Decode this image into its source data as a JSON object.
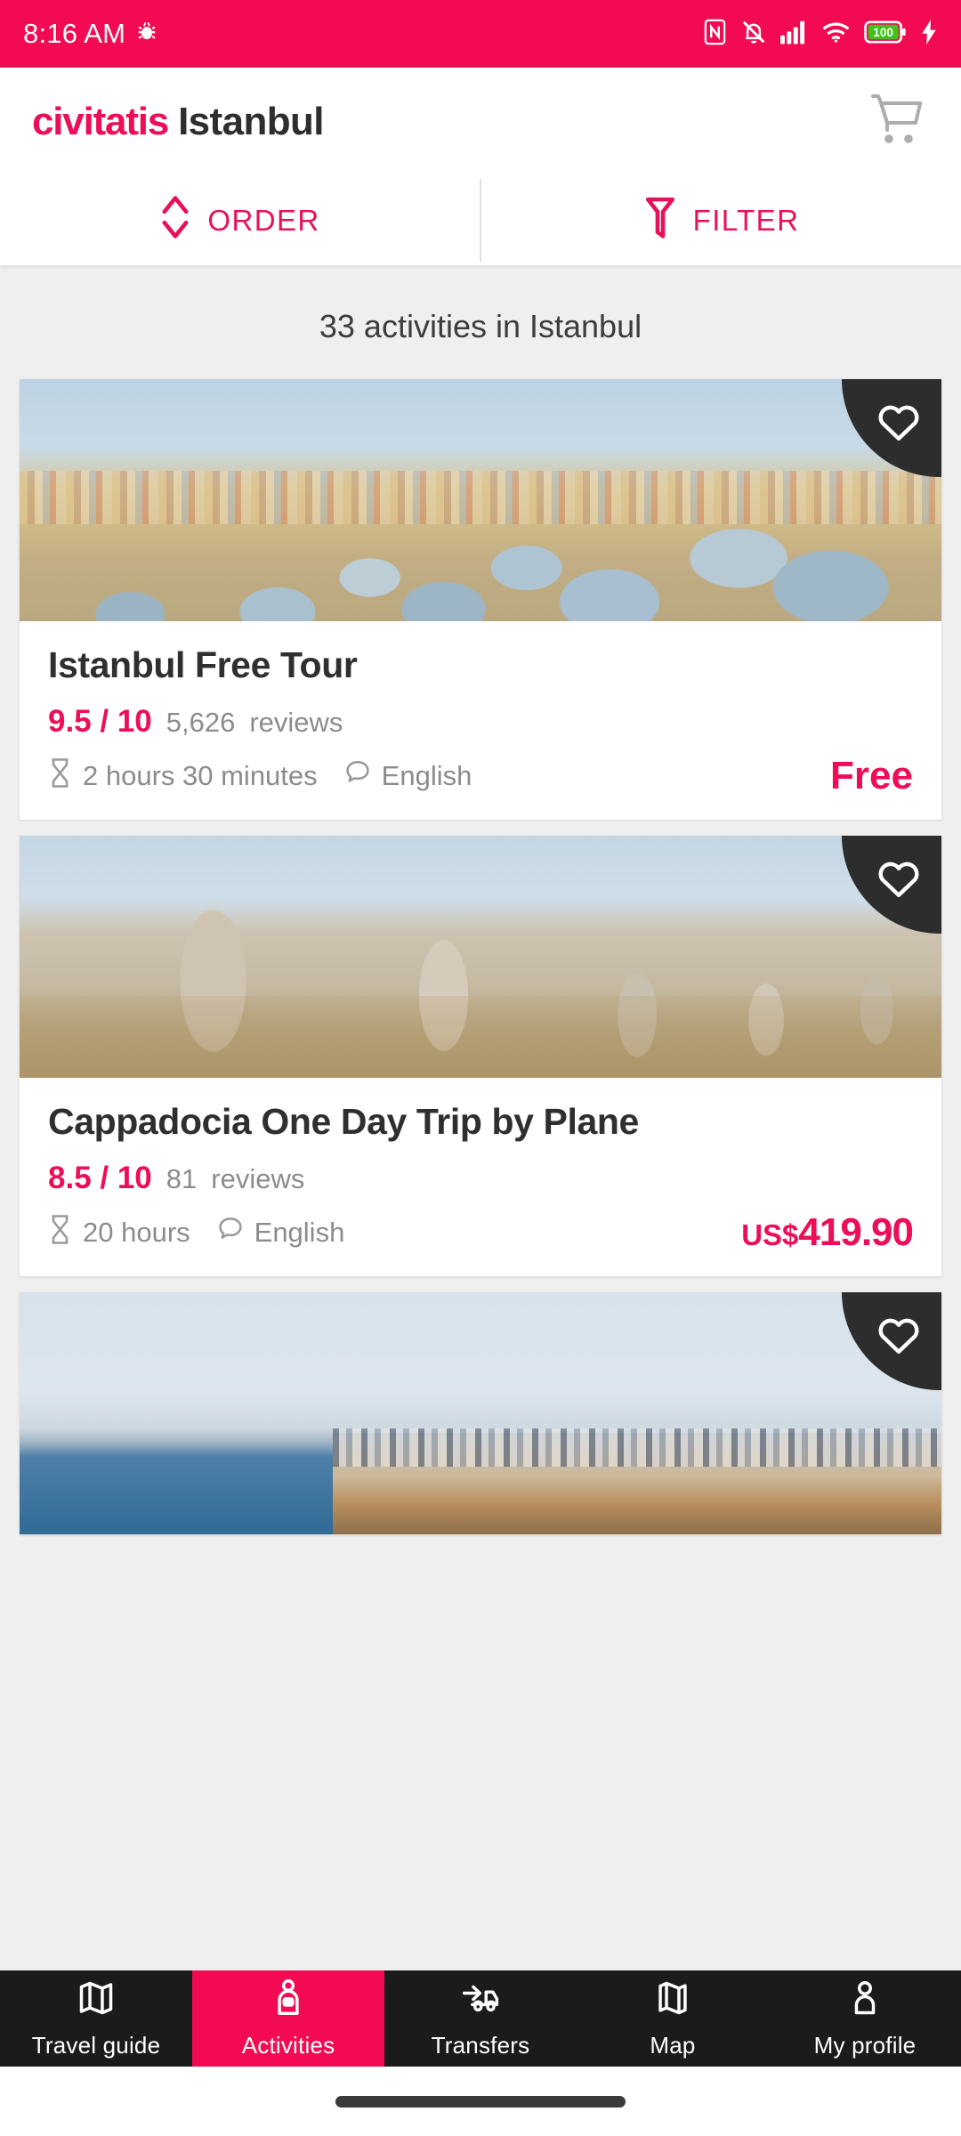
{
  "status_bar": {
    "time": "8:16 AM",
    "icons": [
      "bug-icon",
      "nfc-icon",
      "vibrate-off-icon",
      "signal-icon",
      "wifi-icon",
      "battery-icon",
      "charging-bolt-icon"
    ],
    "battery_level": "100",
    "background_color": "#f20a52"
  },
  "header": {
    "brand": "civitatis",
    "city": "Istanbul",
    "cart_icon": "cart-icon",
    "brand_color": "#ec0e57"
  },
  "toolbar": {
    "order_label": "ORDER",
    "order_icon": "sort-updown-icon",
    "filter_label": "FILTER",
    "filter_icon": "funnel-icon",
    "accent_color": "#e8105a"
  },
  "results": {
    "count_text": "33 activities in Istanbul"
  },
  "activities": [
    {
      "photo": "istanbul-domes-skyline",
      "title": "Istanbul Free Tour",
      "rating": "9.5 / 10",
      "reviews_count": "5,626",
      "reviews_label": "reviews",
      "duration": "2 hours 30 minutes",
      "language": "English",
      "price_currency": "",
      "price_value": "Free",
      "is_free": true,
      "favorite_icon": "heart-outline-icon"
    },
    {
      "photo": "cappadocia-fairy-chimneys",
      "title": "Cappadocia One Day Trip by Plane",
      "rating": "8.5 / 10",
      "reviews_count": "81",
      "reviews_label": "reviews",
      "duration": "20 hours",
      "language": "English",
      "price_currency": "US$",
      "price_value": "419.90",
      "is_free": false,
      "favorite_icon": "heart-outline-icon"
    },
    {
      "photo": "bosphorus-city-view",
      "title": "",
      "rating": "",
      "reviews_count": "",
      "reviews_label": "",
      "duration": "",
      "language": "",
      "price_currency": "",
      "price_value": "",
      "is_free": false,
      "favorite_icon": "heart-outline-icon"
    }
  ],
  "bottom_nav": {
    "active_index": 1,
    "active_color": "#f20a52",
    "items": [
      {
        "label": "Travel guide",
        "icon": "folded-map-icon"
      },
      {
        "label": "Activities",
        "icon": "guide-person-icon"
      },
      {
        "label": "Transfers",
        "icon": "car-arrow-icon"
      },
      {
        "label": "Map",
        "icon": "map-icon"
      },
      {
        "label": "My profile",
        "icon": "person-icon"
      }
    ]
  }
}
